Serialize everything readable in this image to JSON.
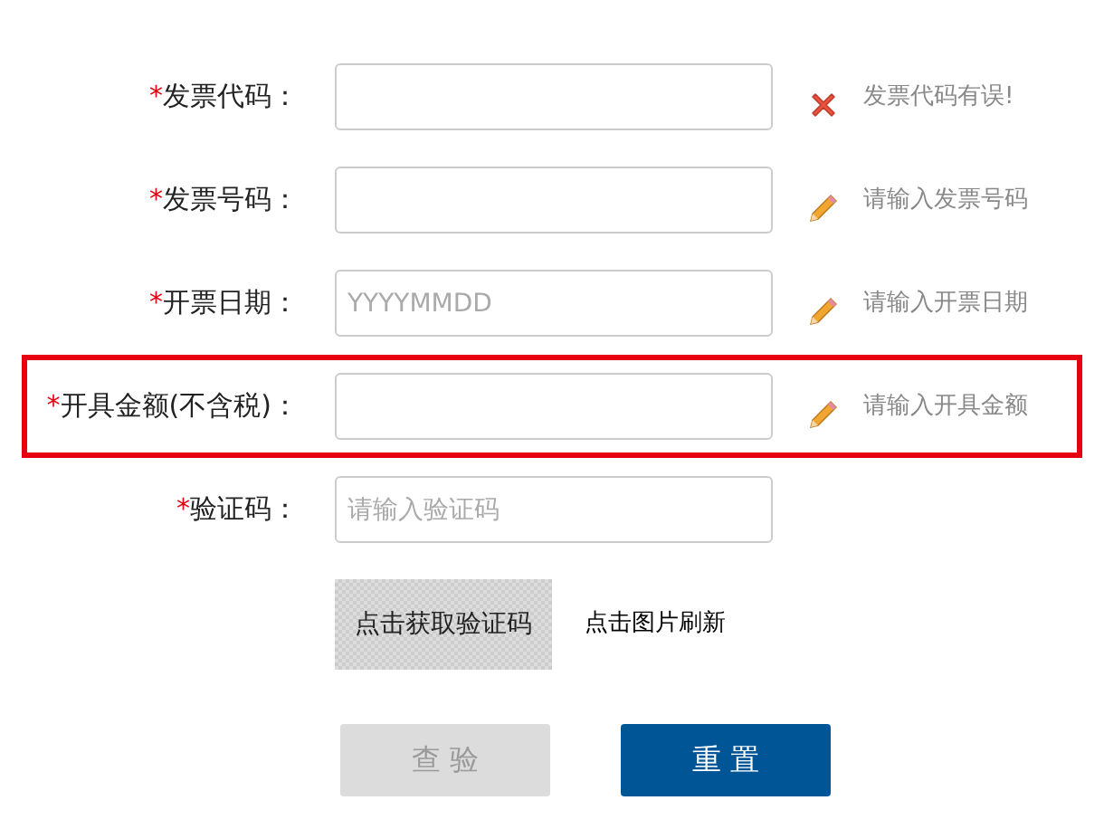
{
  "fields": [
    {
      "mark": "*",
      "label": "发票代码：",
      "highlighted": false,
      "hint": {
        "kind": "error",
        "text": "发票代码有误!"
      }
    },
    {
      "mark": "*",
      "label": "发票号码：",
      "highlighted": false,
      "hint": {
        "kind": "edit",
        "text": "请输入发票号码"
      }
    },
    {
      "mark": "*",
      "label": "开票日期：",
      "placeholder": "YYYYMMDD",
      "highlighted": false,
      "hint": {
        "kind": "edit",
        "text": "请输入开票日期"
      }
    },
    {
      "mark": "*",
      "label": "开具金额(不含税)：",
      "highlighted": true,
      "hint": {
        "kind": "edit",
        "text": "请输入开具金额"
      }
    },
    {
      "mark": "*",
      "label": "验证码：",
      "placeholder": "请输入验证码",
      "highlighted": false
    }
  ],
  "captcha": {
    "image_text": "点击获取验证码",
    "refresh_text": "点击图片刷新"
  },
  "buttons": [
    {
      "label": "查 验",
      "disabled": true
    },
    {
      "label": "重 置",
      "disabled": false
    }
  ]
}
